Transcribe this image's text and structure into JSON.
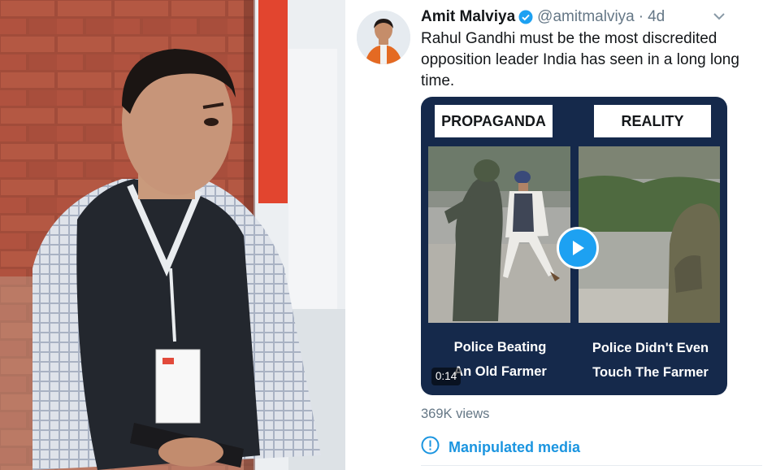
{
  "tweet": {
    "author_name": "Amit Malviya",
    "handle": "@amitmalviya",
    "separator": "·",
    "age": "4d",
    "text": "Rahul Gandhi must be the most discredited opposition leader India has seen in a long long time.",
    "media": {
      "left_label": "PROPAGANDA",
      "right_label": "REALITY",
      "left_caption_line1": "Police Beating",
      "left_caption_line2": "An Old Farmer",
      "right_caption_line1": "Police Didn't Even",
      "right_caption_line2": "Touch The Farmer",
      "duration": "0:14"
    },
    "views": "369K views",
    "manipulated_label": "Manipulated media"
  },
  "icons": {
    "verified": "verified-badge-icon",
    "caret": "chevron-down-icon",
    "play": "play-icon",
    "info": "exclamation-circle-icon"
  },
  "colors": {
    "twitter_blue": "#1da1f2",
    "manipulated_blue": "#1b95e0",
    "video_bg": "#15294b",
    "text_primary": "#14171a",
    "text_secondary": "#657786"
  }
}
